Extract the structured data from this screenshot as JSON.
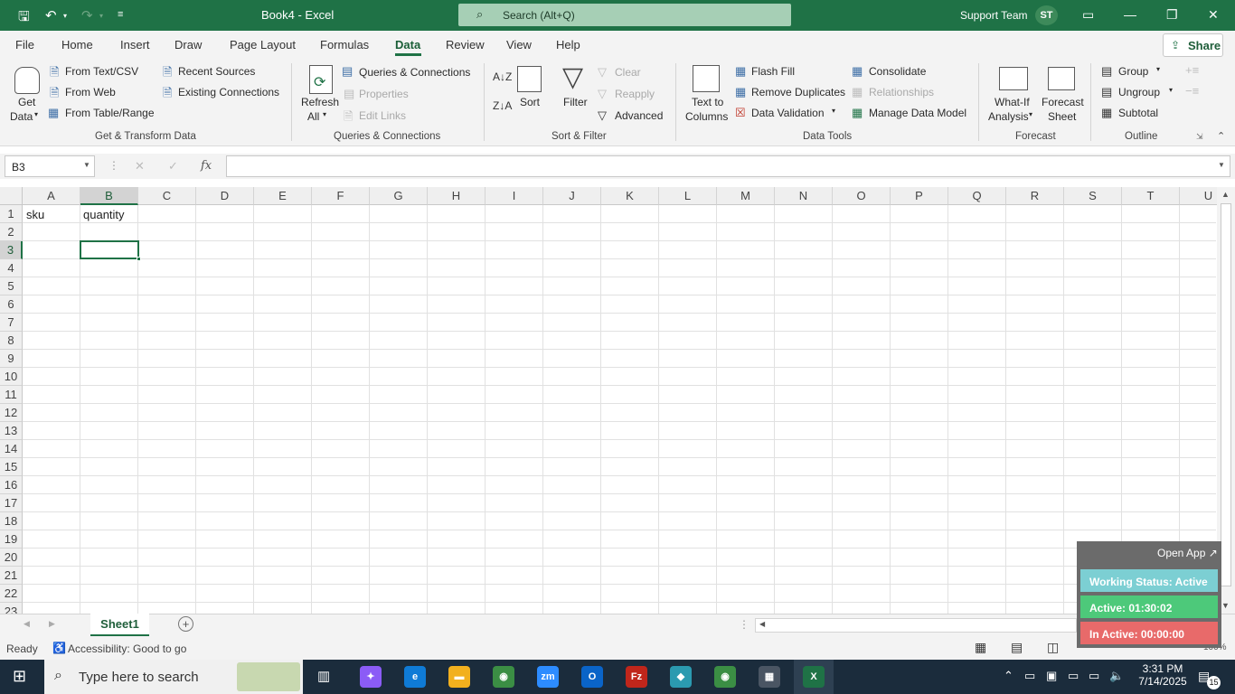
{
  "app": {
    "doc_title": "Book4 - Excel",
    "search_placeholder": "Search (Alt+Q)",
    "user_name": "Support Team",
    "user_initials": "ST"
  },
  "menu": {
    "items": [
      "File",
      "Home",
      "Insert",
      "Draw",
      "Page Layout",
      "Formulas",
      "Data",
      "Review",
      "View",
      "Help"
    ],
    "active": "Data",
    "share": "Share"
  },
  "ribbon": {
    "get_data": [
      "Get",
      "Data"
    ],
    "from_text_csv": "From Text/CSV",
    "from_web": "From Web",
    "from_table_range": "From Table/Range",
    "recent_sources": "Recent Sources",
    "existing_connections": "Existing Connections",
    "group_get_transform": "Get & Transform Data",
    "refresh_all": [
      "Refresh",
      "All"
    ],
    "queries_connections": "Queries & Connections",
    "properties": "Properties",
    "edit_links": "Edit Links",
    "group_queries": "Queries & Connections",
    "sort": "Sort",
    "filter": "Filter",
    "clear": "Clear",
    "reapply": "Reapply",
    "advanced": "Advanced",
    "group_sort_filter": "Sort & Filter",
    "text_to_columns": [
      "Text to",
      "Columns"
    ],
    "flash_fill": "Flash Fill",
    "remove_duplicates": "Remove Duplicates",
    "data_validation": "Data Validation",
    "consolidate": "Consolidate",
    "relationships": "Relationships",
    "manage_data_model": "Manage Data Model",
    "group_data_tools": "Data Tools",
    "what_if": [
      "What-If",
      "Analysis"
    ],
    "forecast_sheet": [
      "Forecast",
      "Sheet"
    ],
    "group_forecast": "Forecast",
    "group": "Group",
    "ungroup": "Ungroup",
    "subtotal": "Subtotal",
    "group_outline": "Outline"
  },
  "formula_bar": {
    "name_box": "B3",
    "fx": "fx",
    "value": ""
  },
  "grid": {
    "columns": [
      "A",
      "B",
      "C",
      "D",
      "E",
      "F",
      "G",
      "H",
      "I",
      "J",
      "K",
      "L",
      "M",
      "N",
      "O",
      "P",
      "Q",
      "R",
      "S",
      "T",
      "U"
    ],
    "rows": [
      "1",
      "2",
      "3",
      "4",
      "5",
      "6",
      "7",
      "8",
      "9",
      "10",
      "11",
      "12",
      "13",
      "14",
      "15",
      "16",
      "17",
      "18",
      "19",
      "20",
      "21",
      "22",
      "23"
    ],
    "selected_cell": "B3",
    "cells": {
      "A1": "sku",
      "B1": "quantity"
    }
  },
  "sheets": {
    "tabs": [
      "Sheet1"
    ],
    "active": "Sheet1"
  },
  "status": {
    "ready": "Ready",
    "accessibility": "Accessibility: Good to go",
    "zoom": "100%"
  },
  "tracker": {
    "open_app": "Open App ↗",
    "working_status": "Working Status: Active",
    "active": "Active: 01:30:02",
    "inactive": "In Active: 00:00:00",
    "colors": {
      "status": "#7ccfd3",
      "active": "#4dc97a",
      "inactive": "#e86a6a"
    }
  },
  "taskbar": {
    "search_placeholder": "Type here to search",
    "time": "3:31 PM",
    "date": "7/14/2025",
    "notifications": "15"
  }
}
